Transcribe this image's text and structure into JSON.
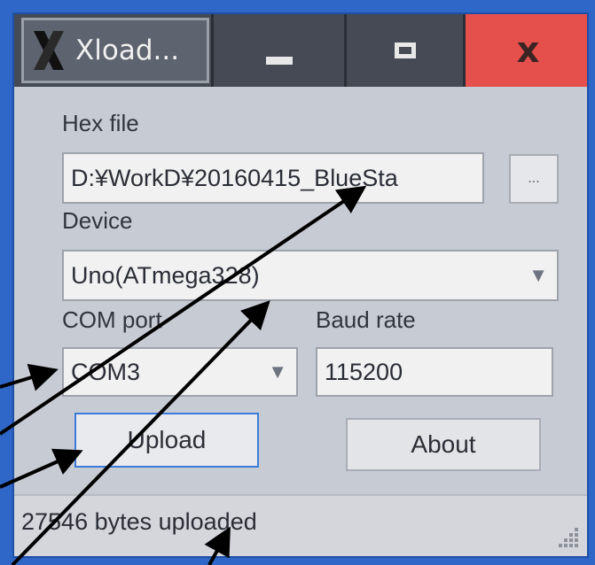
{
  "window": {
    "title": "Xload...",
    "controls": {
      "minimize_icon": "minimize-icon",
      "maximize_icon": "maximize-icon",
      "close_label": "x"
    }
  },
  "form": {
    "hex_file_label": "Hex file",
    "hex_file_value": "D:¥WorkD¥20160415_BlueSta",
    "browse_label": "...",
    "device_label": "Device",
    "device_value": "Uno(ATmega328)",
    "com_port_label": "COM port",
    "com_port_value": "COM3",
    "baud_rate_label": "Baud rate",
    "baud_rate_value": "115200",
    "upload_label": "Upload",
    "about_label": "About"
  },
  "status": {
    "text": "27546 bytes uploaded"
  },
  "colors": {
    "desktop": "#2f67c8",
    "close_button": "#e6504c",
    "window_bg": "#c7cbd3",
    "annotation_arrow": "#000000"
  }
}
